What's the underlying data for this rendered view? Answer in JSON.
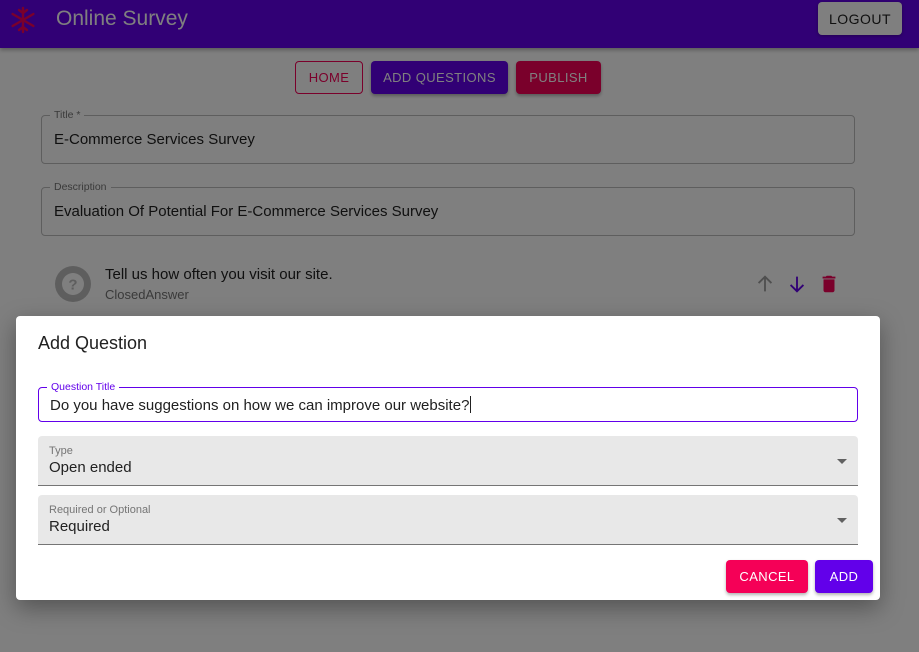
{
  "appbar": {
    "title": "Online Survey",
    "logout_label": "LOGOUT",
    "logo_icon": "snowflake-logo-icon",
    "color": "#6200ea"
  },
  "nav": {
    "home_label": "HOME",
    "add_questions_label": "ADD QUESTIONS",
    "publish_label": "PUBLISH"
  },
  "form": {
    "title_label": "Title *",
    "title_value": "E-Commerce Services Survey",
    "description_label": "Description",
    "description_value": "Evaluation Of Potential For E-Commerce Services Survey"
  },
  "questions": [
    {
      "text": "Tell us how often you visit our site.",
      "type": "ClosedAnswer",
      "icon": "help-circle-icon",
      "actions": [
        "arrow-up-icon",
        "arrow-down-icon",
        "delete-icon"
      ]
    }
  ],
  "dialog": {
    "title": "Add Question",
    "question_title_label": "Question Title",
    "question_title_value": "Do you have suggestions on how we can improve our website?",
    "type_label": "Type",
    "type_value": "Open ended",
    "required_label": "Required or Optional",
    "required_value": "Required",
    "cancel_label": "CANCEL",
    "add_label": "ADD"
  },
  "colors": {
    "primary": "#6200ea",
    "secondary": "#f50057"
  }
}
